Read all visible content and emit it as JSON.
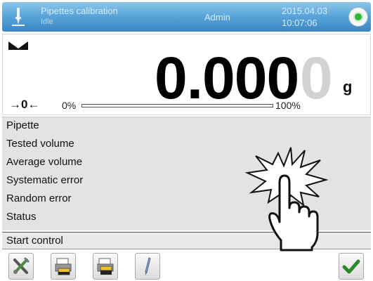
{
  "header": {
    "title": "Pipettes calibration",
    "subtitle": "Idle",
    "user": "Admin",
    "date": "2015.04.03",
    "time": "10:07:06",
    "status_color": "#2db83d"
  },
  "display": {
    "weight_main": "0.000",
    "weight_last_digit": "0",
    "unit": "g",
    "zero_indicator": "→0←",
    "bar_min_label": "0%",
    "bar_max_label": "100%",
    "bar_fill_percent": 0
  },
  "info_rows": [
    {
      "label": "Pipette"
    },
    {
      "label": "Tested volume"
    },
    {
      "label": "Average volume"
    },
    {
      "label": "Systematic error"
    },
    {
      "label": "Random error"
    },
    {
      "label": "Status"
    }
  ],
  "start_control_label": "Start control",
  "toolbar": {
    "icons": [
      "tools-icon",
      "printer-yellow-icon",
      "printer-yellow-icon-2",
      "pipette-icon",
      "checkmark-icon"
    ],
    "accent": "#2a8a2a"
  }
}
